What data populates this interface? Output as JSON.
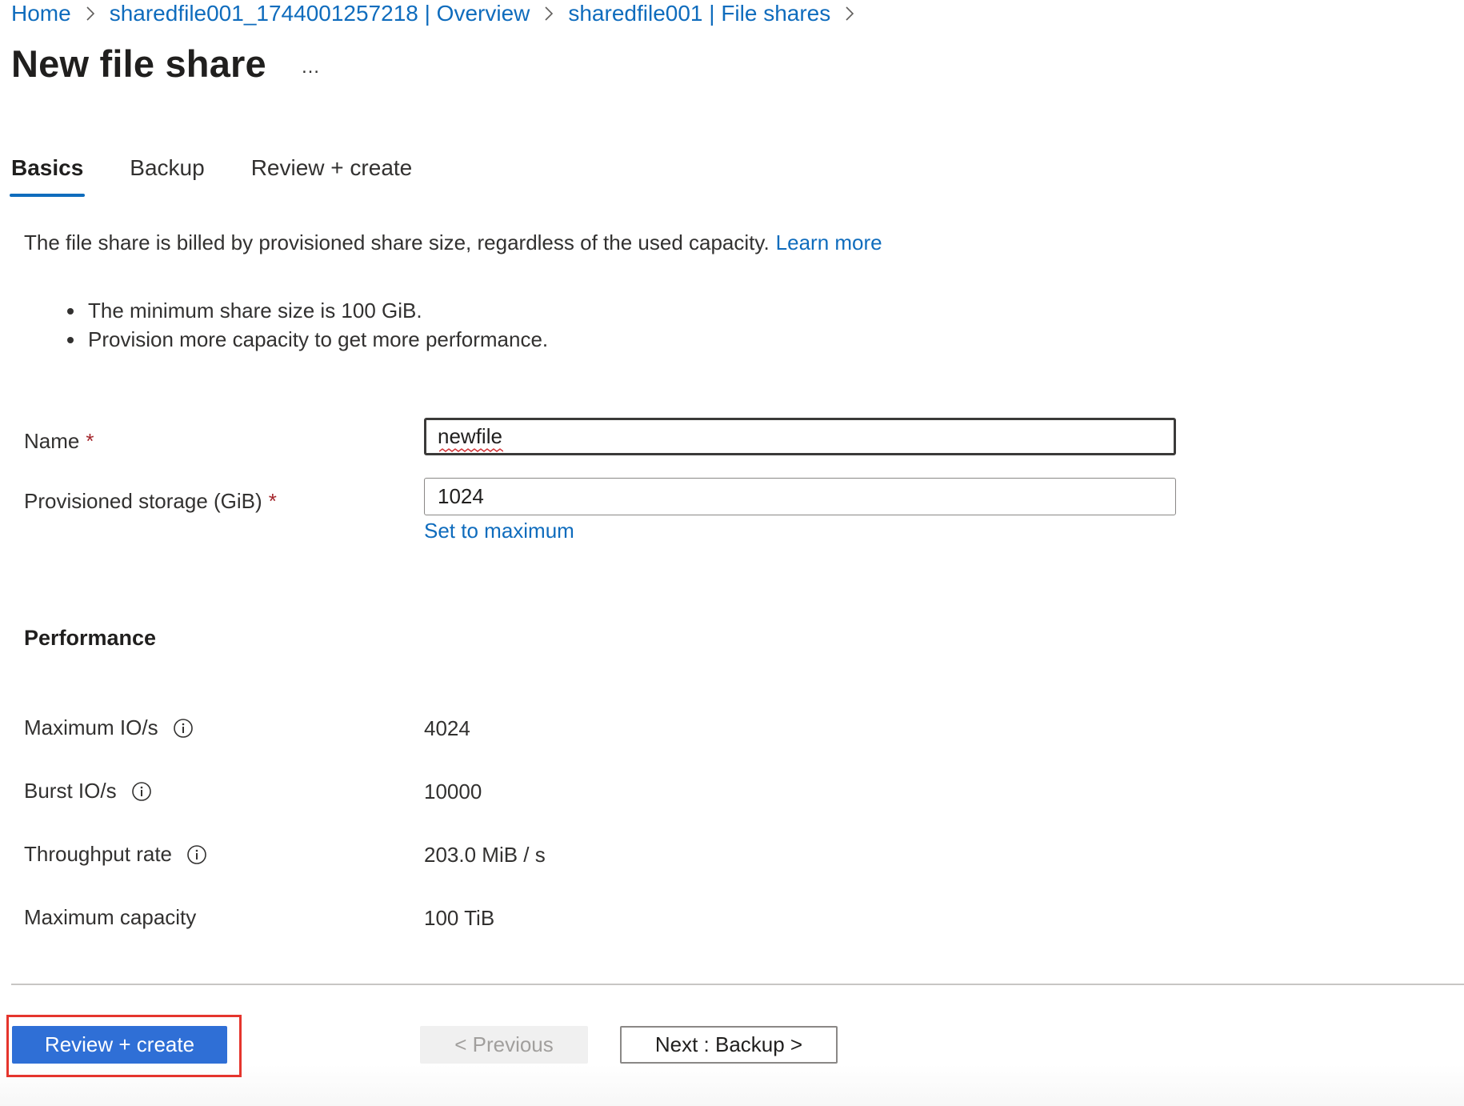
{
  "breadcrumb": {
    "items": [
      "Home",
      "sharedfile001_1744001257218 | Overview",
      "sharedfile001 | File shares"
    ]
  },
  "page": {
    "title": "New file share",
    "more_label": "…"
  },
  "tabs": [
    {
      "label": "Basics",
      "active": true
    },
    {
      "label": "Backup",
      "active": false
    },
    {
      "label": "Review + create",
      "active": false
    }
  ],
  "info": {
    "text": "The file share is billed by provisioned share size, regardless of the used capacity.",
    "learn_more": "Learn more",
    "bullets": [
      "The minimum share size is 100 GiB.",
      "Provision more capacity to get more performance."
    ]
  },
  "form": {
    "name_label": "Name",
    "name_value": "newfile",
    "storage_label": "Provisioned storage (GiB)",
    "storage_value": "1024",
    "required_marker": "*",
    "set_to_maximum": "Set to maximum"
  },
  "performance": {
    "title": "Performance",
    "rows": [
      {
        "label": "Maximum IO/s",
        "value": "4024",
        "info_icon": true
      },
      {
        "label": "Burst IO/s",
        "value": "10000",
        "info_icon": true
      },
      {
        "label": "Throughput rate",
        "value": "203.0 MiB / s",
        "info_icon": true
      },
      {
        "label": "Maximum capacity",
        "value": "100 TiB",
        "info_icon": false
      }
    ]
  },
  "footer": {
    "review_create": "Review + create",
    "previous": "< Previous",
    "next": "Next : Backup >"
  },
  "colors": {
    "accent": "#0f6cbd",
    "primary_button": "#2f6fd6",
    "highlight": "#e5352d",
    "required": "#a4262c"
  },
  "icons": {
    "breadcrumb_separator": "chevron-right-icon",
    "info": "info-icon",
    "more": "ellipsis-icon"
  }
}
